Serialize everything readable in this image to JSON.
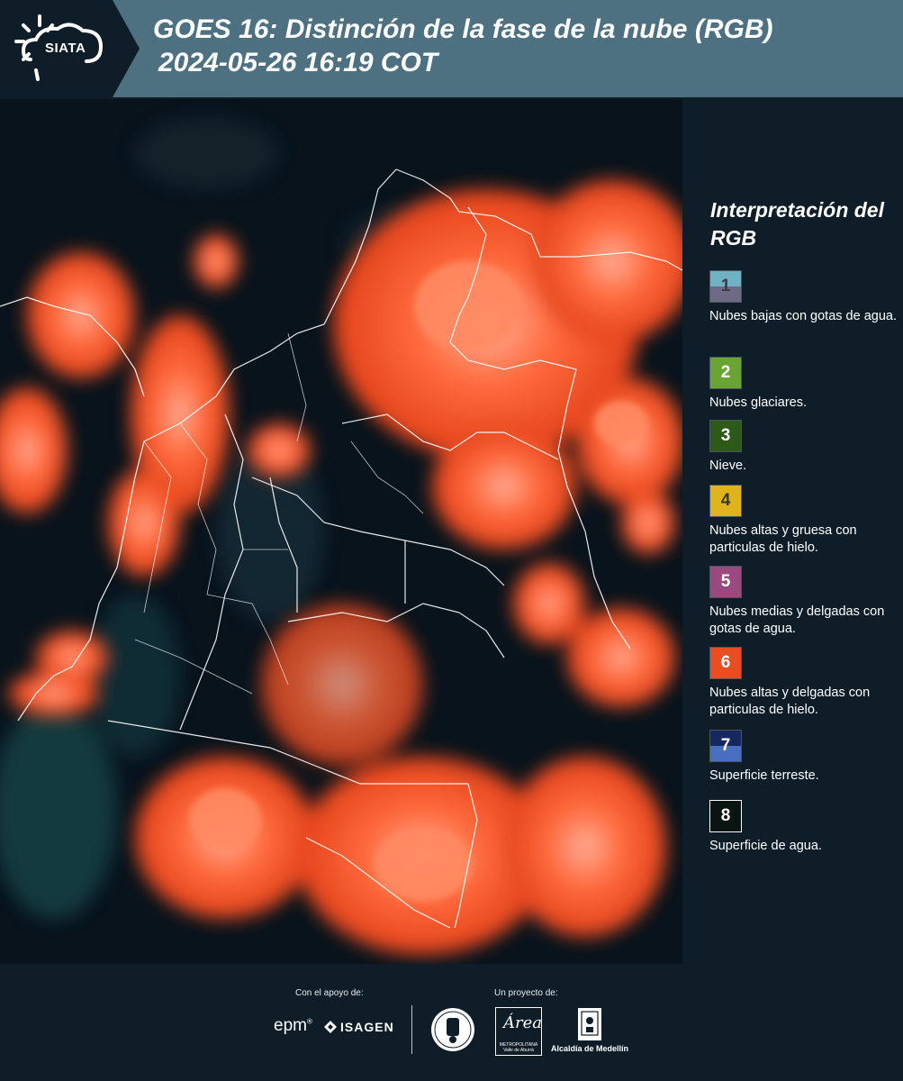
{
  "header": {
    "logo_text": "SIATA",
    "title_line1": "GOES 16: Distinción de la fase de la nube (RGB)",
    "title_line2": "2024-05-26 16:19 COT",
    "background_color": "#4e7181"
  },
  "map": {
    "description_icon": "satellite-map",
    "cloud_color": "#ff5a2e",
    "surface_color": "#07121c",
    "border_color": "#ffffff"
  },
  "legend": {
    "title": "Interpretación del RGB",
    "items": [
      {
        "number": "1",
        "label": "Nubes bajas con gotas de agua.",
        "color_top": "#6fb2c4",
        "color_bottom": "#6e6a86",
        "num_color": "#3a3a4a"
      },
      {
        "number": "2",
        "label": "Nubes glaciares.",
        "color_top": "#6aa534",
        "color_bottom": "#6aa534",
        "num_color": "#ffffff"
      },
      {
        "number": "3",
        "label": "Nieve.",
        "color_top": "#2d5a16",
        "color_bottom": "#2d5a16",
        "num_color": "#ffffff"
      },
      {
        "number": "4",
        "label": "Nubes altas y gruesa con particulas de hielo.",
        "color_top": "#e0b21c",
        "color_bottom": "#e0b21c",
        "num_color": "#333333"
      },
      {
        "number": "5",
        "label": "Nubes medias y delgadas con gotas de agua.",
        "color_top": "#9a4a7e",
        "color_bottom": "#9a4a7e",
        "num_color": "#ffffff"
      },
      {
        "number": "6",
        "label": "Nubes altas y delgadas con particulas de hielo.",
        "color_top": "#e94e22",
        "color_bottom": "#e94e22",
        "num_color": "#ffffff"
      },
      {
        "number": "7",
        "label": "Superficie terreste.",
        "color_top": "#16285e",
        "color_bottom": "#4a6ec0",
        "num_color": "#ffffff"
      },
      {
        "number": "8",
        "label": "Superficie de agua.",
        "color_top": "#0a1410",
        "color_bottom": "#0a1410",
        "num_color": "#ffffff"
      }
    ]
  },
  "footer": {
    "support_label": "Con el apoyo de:",
    "project_label": "Un proyecto de:",
    "epm": "epm",
    "isagen": "ISAGEN",
    "area_metro": "Área",
    "area_metro_sub": "METROPOLITANA Valle de Aburrá",
    "medellin": "Alcaldía de Medellín"
  }
}
